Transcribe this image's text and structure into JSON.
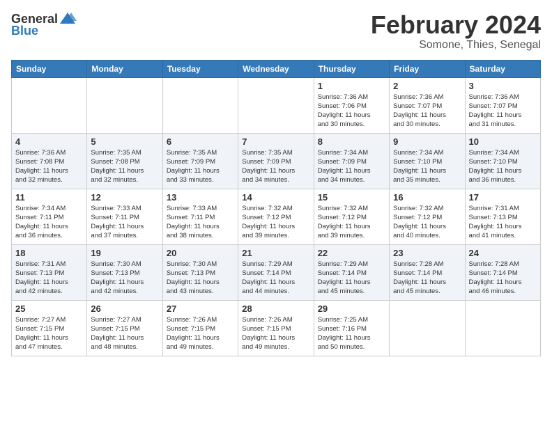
{
  "header": {
    "logo_general": "General",
    "logo_blue": "Blue",
    "month": "February 2024",
    "location": "Somone, Thies, Senegal"
  },
  "weekdays": [
    "Sunday",
    "Monday",
    "Tuesday",
    "Wednesday",
    "Thursday",
    "Friday",
    "Saturday"
  ],
  "weeks": [
    [
      {
        "day": "",
        "info": ""
      },
      {
        "day": "",
        "info": ""
      },
      {
        "day": "",
        "info": ""
      },
      {
        "day": "",
        "info": ""
      },
      {
        "day": "1",
        "info": "Sunrise: 7:36 AM\nSunset: 7:06 PM\nDaylight: 11 hours\nand 30 minutes."
      },
      {
        "day": "2",
        "info": "Sunrise: 7:36 AM\nSunset: 7:07 PM\nDaylight: 11 hours\nand 30 minutes."
      },
      {
        "day": "3",
        "info": "Sunrise: 7:36 AM\nSunset: 7:07 PM\nDaylight: 11 hours\nand 31 minutes."
      }
    ],
    [
      {
        "day": "4",
        "info": "Sunrise: 7:36 AM\nSunset: 7:08 PM\nDaylight: 11 hours\nand 32 minutes."
      },
      {
        "day": "5",
        "info": "Sunrise: 7:35 AM\nSunset: 7:08 PM\nDaylight: 11 hours\nand 32 minutes."
      },
      {
        "day": "6",
        "info": "Sunrise: 7:35 AM\nSunset: 7:09 PM\nDaylight: 11 hours\nand 33 minutes."
      },
      {
        "day": "7",
        "info": "Sunrise: 7:35 AM\nSunset: 7:09 PM\nDaylight: 11 hours\nand 34 minutes."
      },
      {
        "day": "8",
        "info": "Sunrise: 7:34 AM\nSunset: 7:09 PM\nDaylight: 11 hours\nand 34 minutes."
      },
      {
        "day": "9",
        "info": "Sunrise: 7:34 AM\nSunset: 7:10 PM\nDaylight: 11 hours\nand 35 minutes."
      },
      {
        "day": "10",
        "info": "Sunrise: 7:34 AM\nSunset: 7:10 PM\nDaylight: 11 hours\nand 36 minutes."
      }
    ],
    [
      {
        "day": "11",
        "info": "Sunrise: 7:34 AM\nSunset: 7:11 PM\nDaylight: 11 hours\nand 36 minutes."
      },
      {
        "day": "12",
        "info": "Sunrise: 7:33 AM\nSunset: 7:11 PM\nDaylight: 11 hours\nand 37 minutes."
      },
      {
        "day": "13",
        "info": "Sunrise: 7:33 AM\nSunset: 7:11 PM\nDaylight: 11 hours\nand 38 minutes."
      },
      {
        "day": "14",
        "info": "Sunrise: 7:32 AM\nSunset: 7:12 PM\nDaylight: 11 hours\nand 39 minutes."
      },
      {
        "day": "15",
        "info": "Sunrise: 7:32 AM\nSunset: 7:12 PM\nDaylight: 11 hours\nand 39 minutes."
      },
      {
        "day": "16",
        "info": "Sunrise: 7:32 AM\nSunset: 7:12 PM\nDaylight: 11 hours\nand 40 minutes."
      },
      {
        "day": "17",
        "info": "Sunrise: 7:31 AM\nSunset: 7:13 PM\nDaylight: 11 hours\nand 41 minutes."
      }
    ],
    [
      {
        "day": "18",
        "info": "Sunrise: 7:31 AM\nSunset: 7:13 PM\nDaylight: 11 hours\nand 42 minutes."
      },
      {
        "day": "19",
        "info": "Sunrise: 7:30 AM\nSunset: 7:13 PM\nDaylight: 11 hours\nand 42 minutes."
      },
      {
        "day": "20",
        "info": "Sunrise: 7:30 AM\nSunset: 7:13 PM\nDaylight: 11 hours\nand 43 minutes."
      },
      {
        "day": "21",
        "info": "Sunrise: 7:29 AM\nSunset: 7:14 PM\nDaylight: 11 hours\nand 44 minutes."
      },
      {
        "day": "22",
        "info": "Sunrise: 7:29 AM\nSunset: 7:14 PM\nDaylight: 11 hours\nand 45 minutes."
      },
      {
        "day": "23",
        "info": "Sunrise: 7:28 AM\nSunset: 7:14 PM\nDaylight: 11 hours\nand 45 minutes."
      },
      {
        "day": "24",
        "info": "Sunrise: 7:28 AM\nSunset: 7:14 PM\nDaylight: 11 hours\nand 46 minutes."
      }
    ],
    [
      {
        "day": "25",
        "info": "Sunrise: 7:27 AM\nSunset: 7:15 PM\nDaylight: 11 hours\nand 47 minutes."
      },
      {
        "day": "26",
        "info": "Sunrise: 7:27 AM\nSunset: 7:15 PM\nDaylight: 11 hours\nand 48 minutes."
      },
      {
        "day": "27",
        "info": "Sunrise: 7:26 AM\nSunset: 7:15 PM\nDaylight: 11 hours\nand 49 minutes."
      },
      {
        "day": "28",
        "info": "Sunrise: 7:26 AM\nSunset: 7:15 PM\nDaylight: 11 hours\nand 49 minutes."
      },
      {
        "day": "29",
        "info": "Sunrise: 7:25 AM\nSunset: 7:16 PM\nDaylight: 11 hours\nand 50 minutes."
      },
      {
        "day": "",
        "info": ""
      },
      {
        "day": "",
        "info": ""
      }
    ]
  ]
}
